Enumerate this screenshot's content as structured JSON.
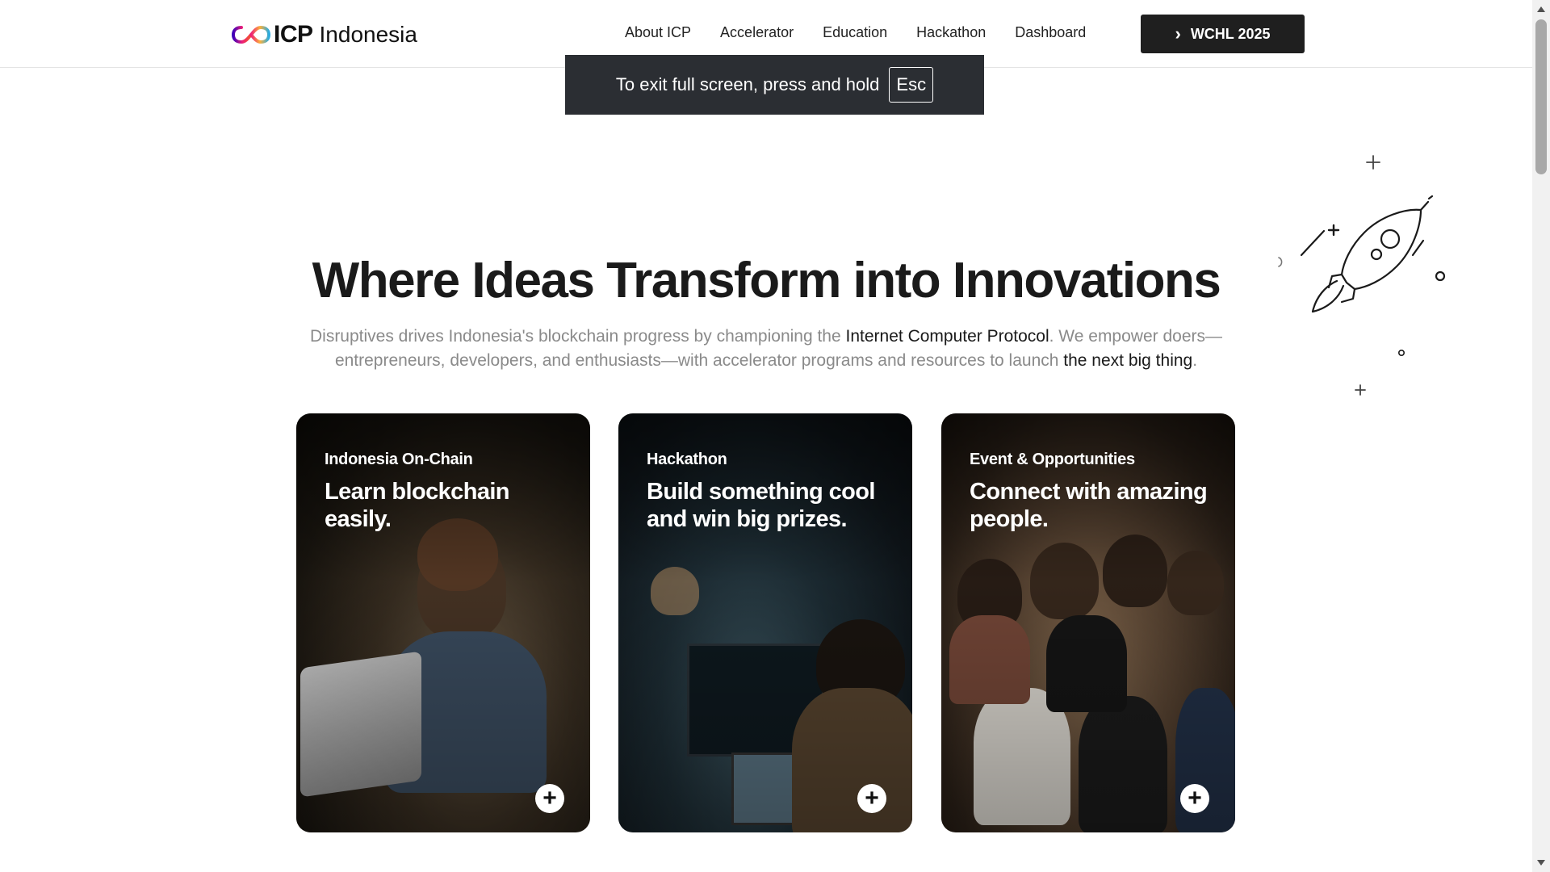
{
  "header": {
    "logo": {
      "brand": "ICP",
      "suffix": "Indonesia"
    },
    "nav": [
      "About ICP",
      "Accelerator",
      "Education",
      "Hackathon",
      "Dashboard"
    ],
    "cta_label": "WCHL 2025"
  },
  "toast": {
    "text": "To exit full screen, press and hold",
    "key": "Esc"
  },
  "hero": {
    "title": "Where Ideas Transform into Innovations",
    "desc_1": "Disruptives drives Indonesia's blockchain progress by championing the ",
    "desc_hl_1": "Internet Computer Protocol",
    "desc_2": ". We empower doers—entrepreneurs, developers, and enthusiasts—with accelerator programs and resources to launch ",
    "desc_hl_2": "the next big thing",
    "desc_3": "."
  },
  "cards": [
    {
      "eyebrow": "Indonesia On-Chain",
      "headline": "Learn blockchain easily."
    },
    {
      "eyebrow": "Hackathon",
      "headline": "Build something cool and win big prizes."
    },
    {
      "eyebrow": "Event & Opportunities",
      "headline": "Connect with amazing people."
    }
  ],
  "icons": {
    "logo": "infinity-logo-icon",
    "cta": "chevron-right-icon",
    "card_action": "plus-circle-icon",
    "decoration": "rocket-icon"
  }
}
